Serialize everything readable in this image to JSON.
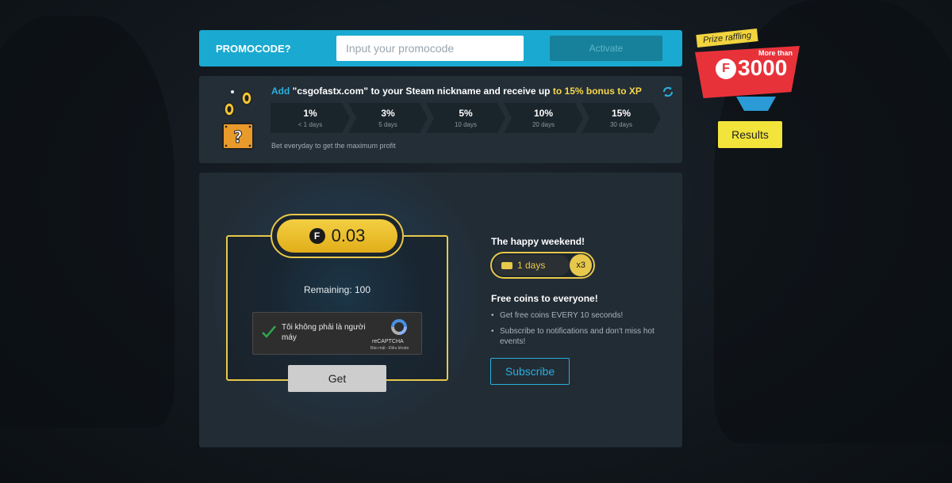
{
  "promo": {
    "label": "PROMOCODE?",
    "input_placeholder": "Input your promocode",
    "input_value": "",
    "activate_label": "Activate"
  },
  "bonus": {
    "text_prefix": "Add",
    "text_quote": "\"csgofastx.com\"",
    "text_middle": "to your Steam nickname and receive up",
    "text_highlight": "to 15% bonus to XP",
    "steps": [
      {
        "percent": "1%",
        "days": "< 1 days"
      },
      {
        "percent": "3%",
        "days": "5 days"
      },
      {
        "percent": "5%",
        "days": "10 days"
      },
      {
        "percent": "10%",
        "days": "20 days"
      },
      {
        "percent": "15%",
        "days": "30 days"
      }
    ],
    "note": "Bet everyday to get the maximum profit"
  },
  "faucet": {
    "coin_symbol": "F",
    "amount": "0.03",
    "remaining": "Remaining: 100",
    "captcha_text": "Tôi không phải là người máy",
    "captcha_brand": "reCAPTCHA",
    "captcha_links": "Bảo mật - Điều khoản",
    "get_label": "Get"
  },
  "weekend": {
    "title": "The happy weekend!",
    "days": "1 days",
    "multiplier": "x3"
  },
  "free_coins": {
    "title": "Free coins to everyone!",
    "items": [
      "Get free coins EVERY 10 seconds!",
      "Subscribe to notifications and don't miss hot events!"
    ],
    "subscribe_label": "Subscribe"
  },
  "prize": {
    "tag": "Prize raffling",
    "more_than": "More than",
    "coin_symbol": "F",
    "amount": "3000",
    "results_label": "Results"
  },
  "colors": {
    "accent_blue": "#1aa9d0",
    "gold": "#e7c84a",
    "panel": "#232e37",
    "prize_red": "#e8323a",
    "results_yellow": "#f3e43b"
  }
}
